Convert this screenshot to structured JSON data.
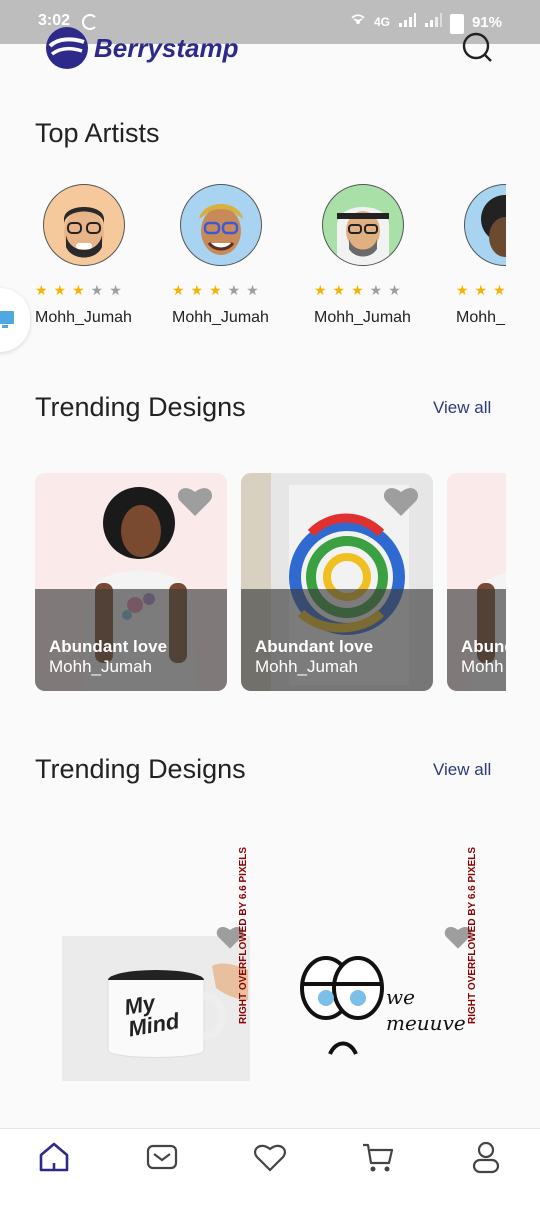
{
  "status": {
    "time": "3:02",
    "network": "4G",
    "battery": "91%"
  },
  "app": {
    "brand": "Berrystamp"
  },
  "top_artists": {
    "title": "Top Artists",
    "artists": [
      {
        "name": "Mohh_Jumah",
        "rating": 3,
        "max": 5
      },
      {
        "name": "Mohh_Jumah",
        "rating": 3,
        "max": 5
      },
      {
        "name": "Mohh_Jumah",
        "rating": 3,
        "max": 5
      },
      {
        "name": "Mohh_",
        "rating": 3,
        "max": 5
      }
    ]
  },
  "trending1": {
    "title": "Trending Designs",
    "view_all": "View all",
    "cards": [
      {
        "title": "Abundant love",
        "artist": "Mohh_Jumah"
      },
      {
        "title": "Abundant love",
        "artist": "Mohh_Jumah"
      },
      {
        "title": "Abund",
        "artist": "Mohh"
      }
    ]
  },
  "trending2": {
    "title": "Trending Designs",
    "view_all": "View all",
    "overflow_label": "RIGHT OVERFLOWED BY 6.6 PIXELS",
    "mug_text": "My Mind",
    "face_text": "we meuuve"
  },
  "colors": {
    "brand": "#2e2a8c",
    "star": "#f4b400",
    "star_off": "#9e9e9e",
    "overflow": "#8b0000"
  }
}
